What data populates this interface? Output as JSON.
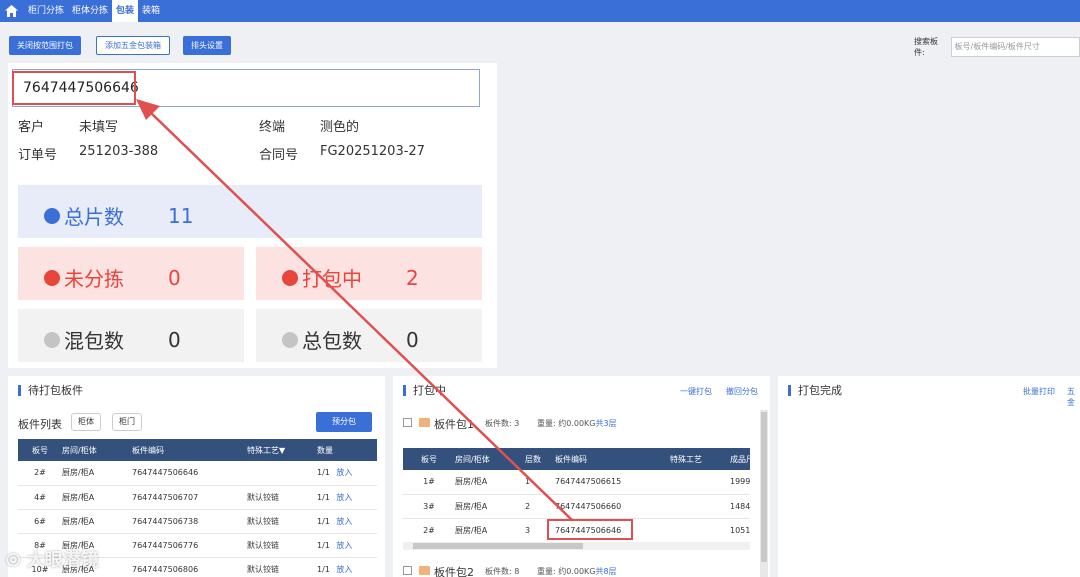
{
  "nav": {
    "tabs": [
      "柜门分拣",
      "柜体分拣",
      "包装",
      "装箱"
    ],
    "active": 2
  },
  "toolbar": {
    "btn1": "关闭按范围打包",
    "btn2": "添加五金包装箱",
    "btn3": "排头设置"
  },
  "search": {
    "label": "搜索板件:",
    "placeholder": "板号/板件编码/板件尺寸"
  },
  "scan": {
    "value": "7647447506646"
  },
  "order": {
    "customer_label": "客户",
    "customer": "未填写",
    "terminal_label": "终端",
    "terminal": "测色的",
    "order_no_label": "订单号",
    "order_no": "251203-388",
    "contract_label": "合同号",
    "contract": "FG20251203-27"
  },
  "stats": {
    "total_label": "总片数",
    "total": "11",
    "unsorted_label": "未分拣",
    "unsorted": "0",
    "packing_label": "打包中",
    "packing": "2",
    "mixed_label": "混包数",
    "mixed": "0",
    "packages_label": "总包数",
    "packages": "0"
  },
  "colors": {
    "accent": "#3a6fd8",
    "danger": "#e8453c",
    "total_bg": "#e8ecf8",
    "red_bg": "#fde2e2",
    "gray_bg": "#f2f2f2"
  },
  "pending": {
    "title": "待打包板件",
    "list_label": "板件列表",
    "chip1": "柜体",
    "chip2": "柜门",
    "pre_pack": "预分包",
    "headers": [
      "板号",
      "房间/柜体",
      "板件编码",
      "特殊工艺▼",
      "数量"
    ],
    "rows": [
      {
        "no": "2#",
        "room": "厨房/柜A",
        "code": "7647447506646",
        "craft": "",
        "qty": "1/1",
        "action": "放入"
      },
      {
        "no": "4#",
        "room": "厨房/柜A",
        "code": "7647447506707",
        "craft": "默认铰链",
        "qty": "1/1",
        "action": "放入"
      },
      {
        "no": "6#",
        "room": "厨房/柜A",
        "code": "7647447506738",
        "craft": "默认铰链",
        "qty": "1/1",
        "action": "放入"
      },
      {
        "no": "8#",
        "room": "厨房/柜A",
        "code": "7647447506776",
        "craft": "默认铰链",
        "qty": "1/1",
        "action": "放入"
      },
      {
        "no": "10#",
        "room": "厨房/柜A",
        "code": "7647447506806",
        "craft": "默认铰链",
        "qty": "1/1",
        "action": "放入"
      }
    ]
  },
  "packing": {
    "title": "打包中",
    "one_click": "一键打包",
    "withdraw": "撤回分包",
    "pkg1": {
      "name": "板件包1",
      "count_label": "板件数:",
      "count": "3",
      "weight_label": "重量:",
      "weight": "约0.00KG",
      "layers": "共3层"
    },
    "headers": [
      "板号",
      "房间/柜体",
      "层数",
      "板件编码",
      "特殊工艺",
      "成品尺"
    ],
    "rows": [
      {
        "no": "1#",
        "room": "厨房/柜A",
        "layer": "1",
        "code": "7647447506615",
        "craft": "",
        "size": "1999"
      },
      {
        "no": "3#",
        "room": "厨房/柜A",
        "layer": "2",
        "code": "7647447506660",
        "craft": "",
        "size": "1484"
      },
      {
        "no": "2#",
        "room": "厨房/柜A",
        "layer": "3",
        "code": "7647447506646",
        "craft": "",
        "size": "1051"
      }
    ],
    "pkg2": {
      "name": "板件包2",
      "count_label": "板件数:",
      "count": "8",
      "weight_label": "重量:",
      "weight": "约0.00KG",
      "layers": "共8层"
    }
  },
  "done": {
    "title": "打包完成",
    "batch_print": "批量打印",
    "more": "五金"
  },
  "watermark": "大眼潜镜"
}
